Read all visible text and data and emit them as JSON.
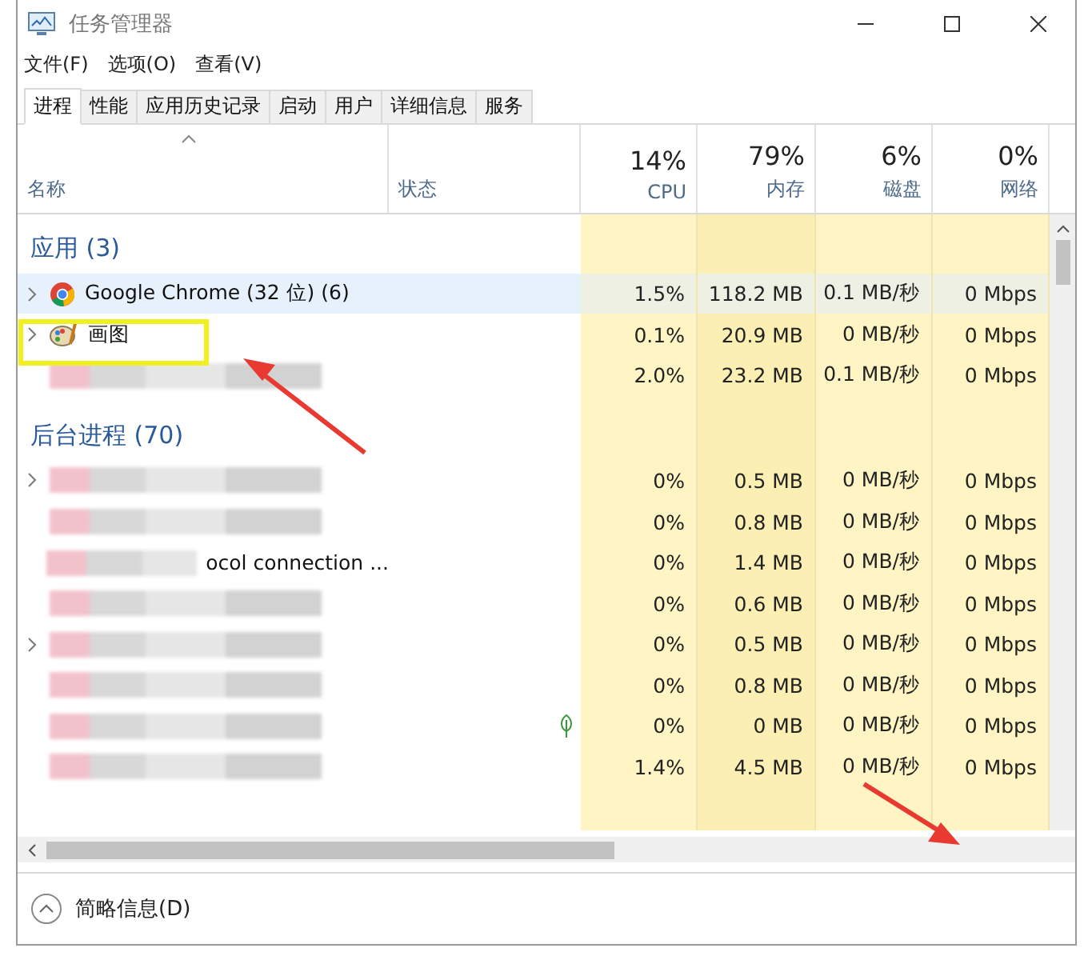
{
  "window": {
    "title": "任务管理器"
  },
  "menu": [
    "文件(F)",
    "选项(O)",
    "查看(V)"
  ],
  "tabs": [
    {
      "label": "进程",
      "selected": true
    },
    {
      "label": "性能",
      "selected": false
    },
    {
      "label": "应用历史记录",
      "selected": false
    },
    {
      "label": "启动",
      "selected": false
    },
    {
      "label": "用户",
      "selected": false
    },
    {
      "label": "详细信息",
      "selected": false
    },
    {
      "label": "服务",
      "selected": false
    }
  ],
  "columns": {
    "name": "名称",
    "status": "状态",
    "metrics": [
      {
        "total": "14%",
        "label": "CPU"
      },
      {
        "total": "79%",
        "label": "内存"
      },
      {
        "total": "6%",
        "label": "磁盘"
      },
      {
        "total": "0%",
        "label": "网络"
      }
    ]
  },
  "groups": [
    {
      "title": "应用 (3)",
      "rows": [
        {
          "kind": "chrome",
          "name": "Google Chrome (32 位) (6)",
          "expandable": true,
          "highlighted": true,
          "suspended": false,
          "values": [
            "1.5%",
            "118.2 MB",
            "0.1 MB/秒",
            "0 Mbps"
          ]
        },
        {
          "kind": "paint",
          "name": "画图",
          "expandable": true,
          "highlighted": false,
          "suspended": false,
          "values": [
            "0.1%",
            "20.9 MB",
            "0 MB/秒",
            "0 Mbps"
          ]
        },
        {
          "kind": "blurred",
          "expandable": false,
          "highlighted": false,
          "suspended": false,
          "values": [
            "2.0%",
            "23.2 MB",
            "0.1 MB/秒",
            "0 Mbps"
          ]
        }
      ]
    },
    {
      "title": "后台进程 (70)",
      "rows": [
        {
          "kind": "blurred",
          "expandable": true,
          "highlighted": false,
          "suspended": false,
          "values": [
            "0%",
            "0.5 MB",
            "0 MB/秒",
            "0 Mbps"
          ]
        },
        {
          "kind": "blurred",
          "expandable": false,
          "highlighted": false,
          "suspended": false,
          "values": [
            "0%",
            "0.8 MB",
            "0 MB/秒",
            "0 Mbps"
          ]
        },
        {
          "kind": "blurred",
          "name": "ocol connection ...",
          "expandable": false,
          "highlighted": false,
          "suspended": false,
          "values": [
            "0%",
            "1.4 MB",
            "0 MB/秒",
            "0 Mbps"
          ]
        },
        {
          "kind": "blurred",
          "expandable": false,
          "highlighted": false,
          "suspended": false,
          "values": [
            "0%",
            "0.6 MB",
            "0 MB/秒",
            "0 Mbps"
          ]
        },
        {
          "kind": "blurred",
          "expandable": true,
          "highlighted": false,
          "suspended": false,
          "values": [
            "0%",
            "0.5 MB",
            "0 MB/秒",
            "0 Mbps"
          ]
        },
        {
          "kind": "blurred",
          "expandable": false,
          "highlighted": false,
          "suspended": false,
          "values": [
            "0%",
            "0.8 MB",
            "0 MB/秒",
            "0 Mbps"
          ]
        },
        {
          "kind": "blurred",
          "expandable": false,
          "highlighted": false,
          "suspended": true,
          "values": [
            "0%",
            "0 MB",
            "0 MB/秒",
            "0 Mbps"
          ]
        },
        {
          "kind": "blurred",
          "expandable": false,
          "highlighted": false,
          "suspended": false,
          "values": [
            "1.4%",
            "4.5 MB",
            "0 MB/秒",
            "0 Mbps"
          ]
        }
      ]
    }
  ],
  "footer": {
    "label": "简略信息(D)"
  }
}
